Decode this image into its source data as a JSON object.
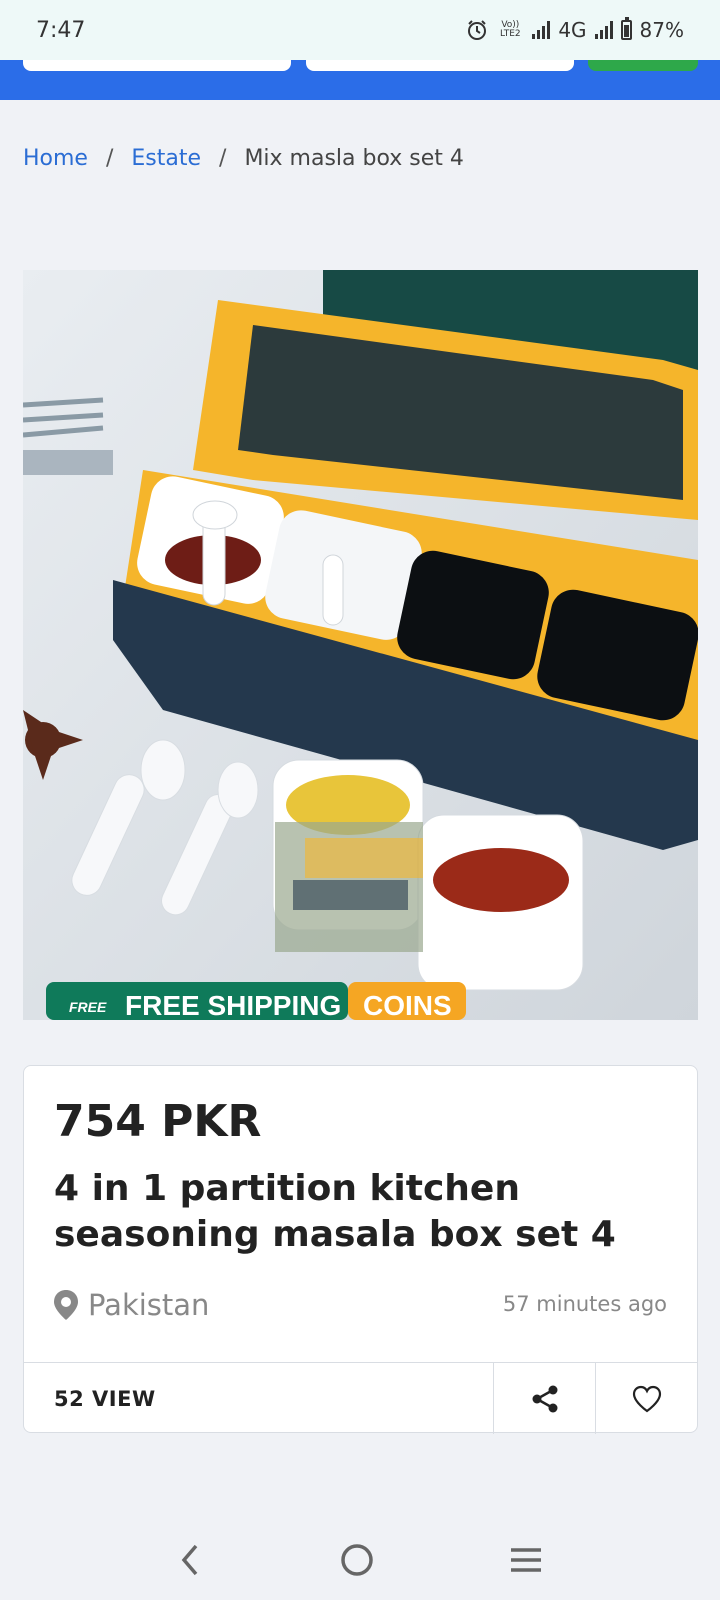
{
  "status_bar": {
    "time": "7:47",
    "carrier_tag": "Vo)) LTE2",
    "network": "4G",
    "battery": "87%"
  },
  "breadcrumb": {
    "home": "Home",
    "separator": "/",
    "category": "Estate",
    "current": "Mix masla box set 4"
  },
  "product": {
    "image_icon": "masala-box-photo",
    "image_banner_left": "FREE SHIPPING",
    "image_banner_right": "COINS",
    "image_banner_tag": "FREE",
    "price": "754 PKR",
    "title": "4 in 1 partition kitchen seasoning masala box set 4",
    "location": "Pakistan",
    "posted": "57 minutes ago",
    "views": "52 VIEW"
  },
  "colors": {
    "header_blue": "#2b6de8",
    "link_blue": "#2b6dd4",
    "banner_green": "#0f7a5a",
    "banner_orange": "#f5a623"
  },
  "nav": {
    "back_icon": "back-icon",
    "home_icon": "home-icon",
    "menu_icon": "menu-icon"
  }
}
